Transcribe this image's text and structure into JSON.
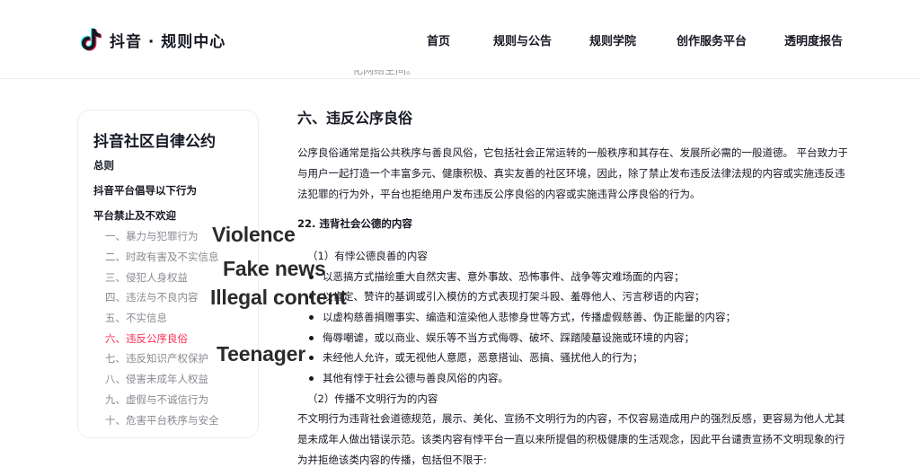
{
  "header": {
    "brand": "抖音 · 规则中心",
    "nav": [
      "首页",
      "规则与公告",
      "规则学院",
      "创作服务平台",
      "透明度报告"
    ]
  },
  "clipped_top_text": "化网络空间。",
  "toc": {
    "title": "抖音社区自律公约",
    "level1": [
      "总则",
      "抖音平台倡导以下行为",
      "平台禁止及不欢迎"
    ],
    "level2": [
      "一、暴力与犯罪行为",
      "二、时政有害及不实信息",
      "三、侵犯人身权益",
      "四、违法与不良内容",
      "五、不实信息",
      "六、违反公序良俗",
      "七、违反知识产权保护",
      "八、侵害未成年人权益",
      "九、虚假与不诚信行为",
      "十、危害平台秩序与安全"
    ],
    "active_index": 5
  },
  "overlay_labels": [
    "Violence",
    "Fake news",
    "Illegal content",
    "Teenager"
  ],
  "content": {
    "section_title": "六、违反公序良俗",
    "intro_lines": [
      "公序良俗通常是指公共秩序与善良风俗，它包括社会正常运转的一般秩序和其存在、发展所必需的一般道德。 平台致力于",
      "与用户一起打造一个丰富多元、健康积极、真实友善的社区环境，因此，除了禁止发布违反法律法规的内容或实施违反违",
      "法犯罪的行为外，平台也拒绝用户发布违反公序良俗的内容或实施违背公序良俗的行为。"
    ],
    "subhead": "22. 违背社会公德的内容",
    "sub1": "（1）有悖公德良善的内容",
    "bullets": [
      "以恶搞方式描绘重大自然灾害、意外事故、恐怖事件、战争等灾难场面的内容；",
      "以肯定、赞许的基调或引入模仿的方式表现打架斗殴、羞辱他人、污言秽语的内容；",
      "以虚构慈善捐赠事实、编造和渲染他人悲惨身世等方式，传播虚假慈善、伪正能量的内容；",
      "侮辱嘲谑，或以商业、娱乐等不当方式侮辱、破坏、踩踏陵墓设施或环境的内容；",
      "未经他人允许，或无视他人意愿，恶意搭讪、恶搞、骚扰他人的行为；",
      "其他有悖于社会公德与善良风俗的内容。"
    ],
    "sub2": "（2）传播不文明行为的内容",
    "outro_lines": [
      "不文明行为违背社会道德规范，展示、美化、宣扬不文明行为的内容，不仅容易造成用户的强烈反感，更容易为他人尤其",
      "是未成年人做出错误示范。该类内容有悖平台一直以来所提倡的积极健康的生活观念，因此平台谴责宣扬不文明现象的行",
      "为并拒绝该类内容的传播，包括但不限于:"
    ]
  },
  "colors": {
    "text": "#161823",
    "muted": "#8a8b91",
    "accent": "#fe2c55",
    "logo_cyan": "#25f4ee"
  },
  "icons": {
    "logo": "douyin-note-icon"
  }
}
